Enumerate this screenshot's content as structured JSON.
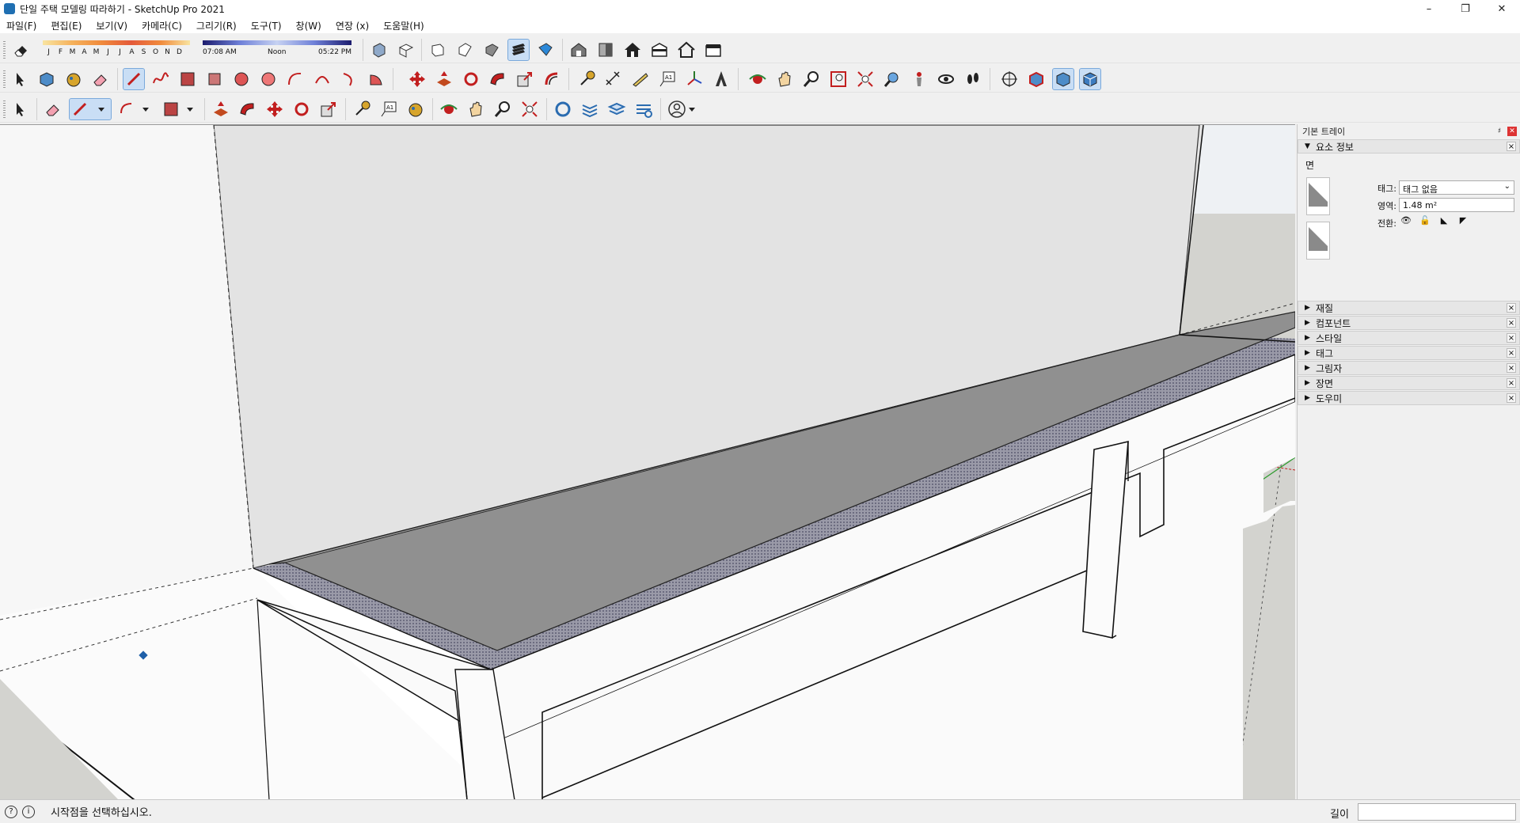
{
  "window": {
    "title": "단일 주택 모델링 따라하기 - SketchUp Pro 2021",
    "controls": [
      "minimize-icon",
      "restore-icon",
      "close-icon"
    ]
  },
  "menu": [
    "파일(F)",
    "편집(E)",
    "보기(V)",
    "카메라(C)",
    "그리기(R)",
    "도구(T)",
    "창(W)",
    "연장 (x)",
    "도움말(H)"
  ],
  "shadow_settings": {
    "months": [
      "J",
      "F",
      "M",
      "A",
      "M",
      "J",
      "J",
      "A",
      "S",
      "O",
      "N",
      "D"
    ],
    "time_start": "07:08 AM",
    "time_mid": "Noon",
    "time_end": "05:22 PM"
  },
  "toolbars": {
    "row1_icons": [
      "eraser-icon",
      "iso-view-icon",
      "top-view-icon",
      "front-view-icon",
      "right-view-icon",
      "back-view-icon",
      "left-view-icon",
      "warehouse-icon",
      "components-icon",
      "house-icon",
      "home-outline-icon",
      "building-icon"
    ],
    "row2_icons": [
      "select-icon",
      "component-icon",
      "paint-bucket-icon",
      "eraser-icon",
      "line-icon",
      "freehand-icon",
      "rectangle-icon",
      "rotated-rectangle-icon",
      "circle-icon",
      "polygon-icon",
      "arc-icon",
      "pie-icon",
      "push-pull-icon",
      "move-icon",
      "rotate-icon",
      "follow-me-icon",
      "scale-icon",
      "offset-icon",
      "tape-measure-icon",
      "dimension-icon",
      "protractor-icon",
      "text-icon",
      "axes-icon",
      "3d-text-icon",
      "orbit-icon",
      "pan-icon",
      "zoom-icon",
      "zoom-window-icon",
      "zoom-extents-icon",
      "previous-view-icon",
      "position-camera-icon",
      "look-around-icon",
      "walk-icon",
      "section-plane-icon",
      "xray-icon",
      "back-edges-icon",
      "shaded-icon"
    ],
    "row3_icons": [
      "select-icon",
      "eraser-icon",
      "pencil-icon",
      "arc-icon",
      "rectangle-icon",
      "push-pull-icon",
      "follow-me-icon",
      "move-icon",
      "rotate-icon",
      "scale-icon",
      "tape-measure-icon",
      "text-icon",
      "paint-bucket-icon",
      "orbit-icon",
      "pan-icon",
      "zoom-icon",
      "zoom-extents-icon",
      "outer-shell-icon",
      "layers-icon",
      "tags-icon",
      "styles-icon",
      "user-icon"
    ]
  },
  "tray": {
    "title": "기본 트레이",
    "entity_info": {
      "header": "요소 정보",
      "entity_type": "면",
      "tag_label": "태그:",
      "tag_value": "태그 없음",
      "area_label": "영역:",
      "area_value": "1.48 m²",
      "toggle_label": "전환:"
    },
    "panels": [
      "재질",
      "컴포넌트",
      "스타일",
      "태그",
      "그림자",
      "장면",
      "도우미"
    ]
  },
  "status": {
    "message": "시작점을 선택하십시오.",
    "measure_label": "길이",
    "measure_value": ""
  }
}
